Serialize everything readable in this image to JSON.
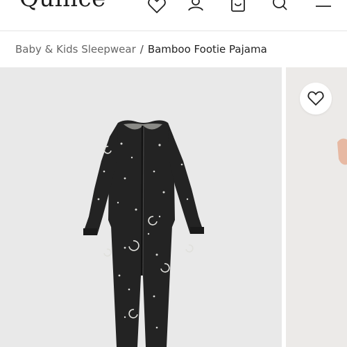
{
  "brand": {
    "name": "Quince"
  },
  "header": {
    "icons": [
      "heart-icon",
      "account-icon",
      "bag-icon",
      "search-icon",
      "menu-icon"
    ]
  },
  "breadcrumb": {
    "parent": "Baby & Kids Sleepwear",
    "separator": "/",
    "current": "Bamboo Footie Pajama"
  },
  "gallery": {
    "main_image": "black footie pajama with moon and star print",
    "next_image": "partial model photo",
    "favorite_icon": "heart-outline-icon"
  },
  "colors": {
    "header_bg": "#ffffff",
    "photo_bg": "#e9e9e9",
    "garment": "#222222",
    "text": "#222222",
    "muted_text": "#666666"
  }
}
